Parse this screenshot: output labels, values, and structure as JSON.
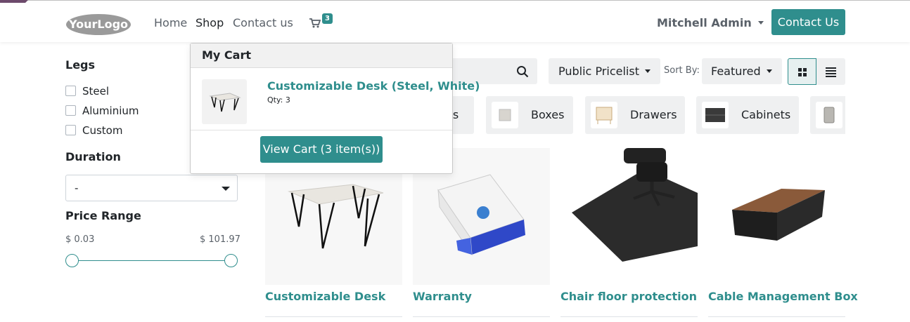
{
  "header": {
    "logo_text": "YourLogo",
    "nav": [
      "Home",
      "Shop",
      "Contact us"
    ],
    "active_nav": "Shop",
    "cart_count": "3",
    "user_name": "Mitchell Admin",
    "contact_button": "Contact Us"
  },
  "sidebar": {
    "legs_title": "Legs",
    "legs_options": [
      "Steel",
      "Aluminium",
      "Custom"
    ],
    "duration_title": "Duration",
    "duration_value": "-",
    "price_title": "Price Range",
    "price_min": "$ 0.03",
    "price_max": "$ 101.97",
    "price_slider": {
      "min_value": 0.03,
      "max_value": 101.97,
      "low_fraction": 0.0,
      "high_fraction": 1.0
    }
  },
  "toolbar": {
    "pricelist": "Public Pricelist",
    "sort_label": "Sort By:",
    "sort_value": "Featured"
  },
  "categories": [
    "es",
    "Boxes",
    "Drawers",
    "Cabinets"
  ],
  "products": [
    {
      "name": "Customizable Desk"
    },
    {
      "name": "Warranty"
    },
    {
      "name": "Chair floor protection"
    },
    {
      "name": "Cable Management Box"
    }
  ],
  "cart_popup": {
    "title": "My Cart",
    "item_name": "Customizable Desk (Steel, White)",
    "item_qty": "Qty: 3",
    "view_cart_button": "View Cart (3 item(s))"
  },
  "colors": {
    "primary": "#2f8e8d",
    "corner": "#6d4a6c",
    "chip_bg": "#eff0f1"
  }
}
